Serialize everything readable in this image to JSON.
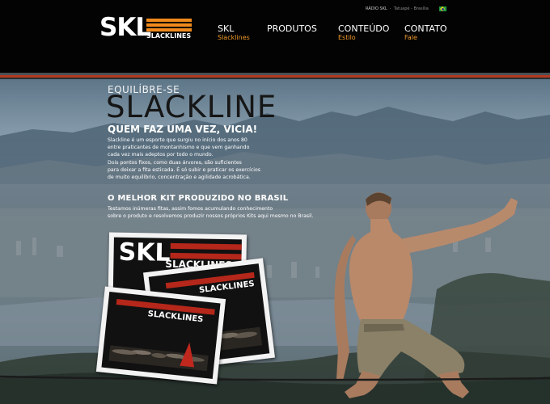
{
  "header": {
    "logo": {
      "main": "SKL",
      "sub": "SLACKLINES"
    },
    "utility": {
      "label": "RÁDIO SKL",
      "location": "Tatuapé - Brasília"
    },
    "nav": [
      {
        "title": "SKL",
        "subtitle": "Slacklines"
      },
      {
        "title": "PRODUTOS",
        "subtitle": ""
      },
      {
        "title": "CONTEÚDO",
        "subtitle": "Estilo"
      },
      {
        "title": "CONTATO",
        "subtitle": "Fale"
      }
    ]
  },
  "hero": {
    "kicker": "EQUILÍBRE-SE",
    "headline": "SLACKLINE",
    "tagline": "QUEM FAZ UMA VEZ, VICIA!",
    "paragraph": [
      "Slackline é um esporte que surgiu no início dos anos 80",
      "entre praticantes de montanhismo e que vem ganhando",
      "cada vez mais adeptos por  todo o mundo.",
      "Dois pontos fixos, como duas árvores, são suficientes",
      "para deixar a fita esticada. É só subir e praticar os exercícios",
      "de muito equilíbrio, concentração e agilidade acrobática."
    ],
    "subheading": "O MELHOR KIT PRODUZIDO NO BRASIL",
    "paragraph2": [
      "Testamos inúmeras fitas, assim fomos acumulando conhecimento",
      "sobre o produto e resolvemos produzir nossos próprios Kits aqui mesmo no Brasil."
    ]
  },
  "photos": [
    {
      "brand": "SKL",
      "sub": "SLACKLINES"
    },
    {
      "brand": "",
      "sub": "SLACKLINES"
    },
    {
      "brand": "",
      "sub": "SLACKLINES"
    }
  ],
  "colors": {
    "accent_orange": "#f08a1c",
    "stripe_red": "#b13a1f",
    "header_bg": "#030303"
  }
}
